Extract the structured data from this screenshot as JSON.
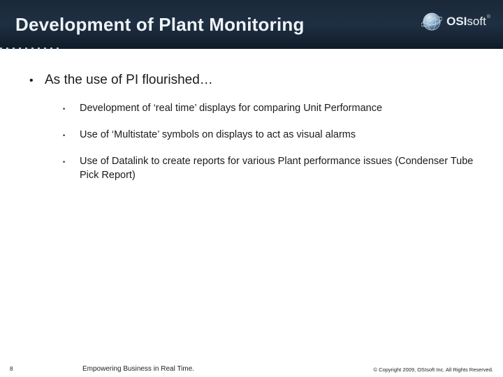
{
  "header": {
    "title": "Development of Plant Monitoring",
    "logo": {
      "brand_bold": "OSI",
      "brand_rest": "soft",
      "registered": "®"
    }
  },
  "content": {
    "lvl1_bullet": "•",
    "lvl2_bullet": "•",
    "lvl1_text": "As the use of PI flourished…",
    "subs": [
      "Development of ‘real time’ displays for comparing Unit Performance",
      "Use of ‘Multistate’ symbols on displays to act as visual alarms",
      "Use of Datalink to create reports for various Plant performance issues (Condenser Tube Pick Report)"
    ]
  },
  "footer": {
    "page": "8",
    "tagline": "Empowering Business in Real Time.",
    "copyright": "© Copyright 2009, OSIsoft Inc. All Rights Reserved."
  }
}
